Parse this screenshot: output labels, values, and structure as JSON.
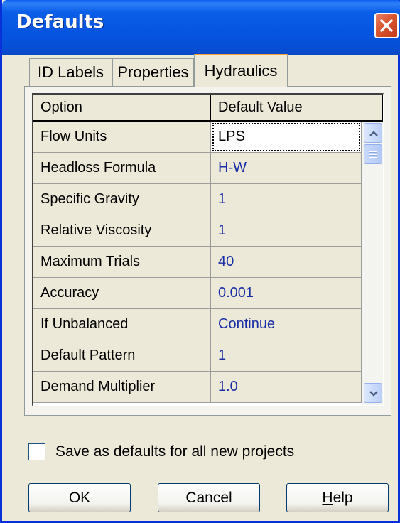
{
  "window": {
    "title": "Defaults"
  },
  "tabs": [
    {
      "label": "ID Labels",
      "active": false
    },
    {
      "label": "Properties",
      "active": false
    },
    {
      "label": "Hydraulics",
      "active": true
    }
  ],
  "grid": {
    "columns": [
      "Option",
      "Default Value"
    ],
    "rows": [
      {
        "option": "Flow Units",
        "value": "LPS"
      },
      {
        "option": "Headloss Formula",
        "value": "H-W"
      },
      {
        "option": "Specific Gravity",
        "value": "1"
      },
      {
        "option": "Relative Viscosity",
        "value": "1"
      },
      {
        "option": "Maximum Trials",
        "value": "40"
      },
      {
        "option": "Accuracy",
        "value": "0.001"
      },
      {
        "option": "If Unbalanced",
        "value": "Continue"
      },
      {
        "option": "Default Pattern",
        "value": "1"
      },
      {
        "option": "Demand Multiplier",
        "value": "1.0"
      }
    ],
    "editing_row": 0
  },
  "checkbox": {
    "label": "Save as defaults for all new projects",
    "checked": false
  },
  "buttons": {
    "ok": "OK",
    "cancel": "Cancel",
    "help_underlined": "H",
    "help_rest": "elp"
  },
  "icons": {
    "close": "close-icon",
    "scroll_up": "scroll-up-arrow-icon",
    "scroll_down": "scroll-down-arrow-icon"
  },
  "colors": {
    "titlebar": "#0554e0",
    "close_button": "#d9542f",
    "dialog_bg": "#ece9d8",
    "value_text": "#1a2fa5"
  }
}
